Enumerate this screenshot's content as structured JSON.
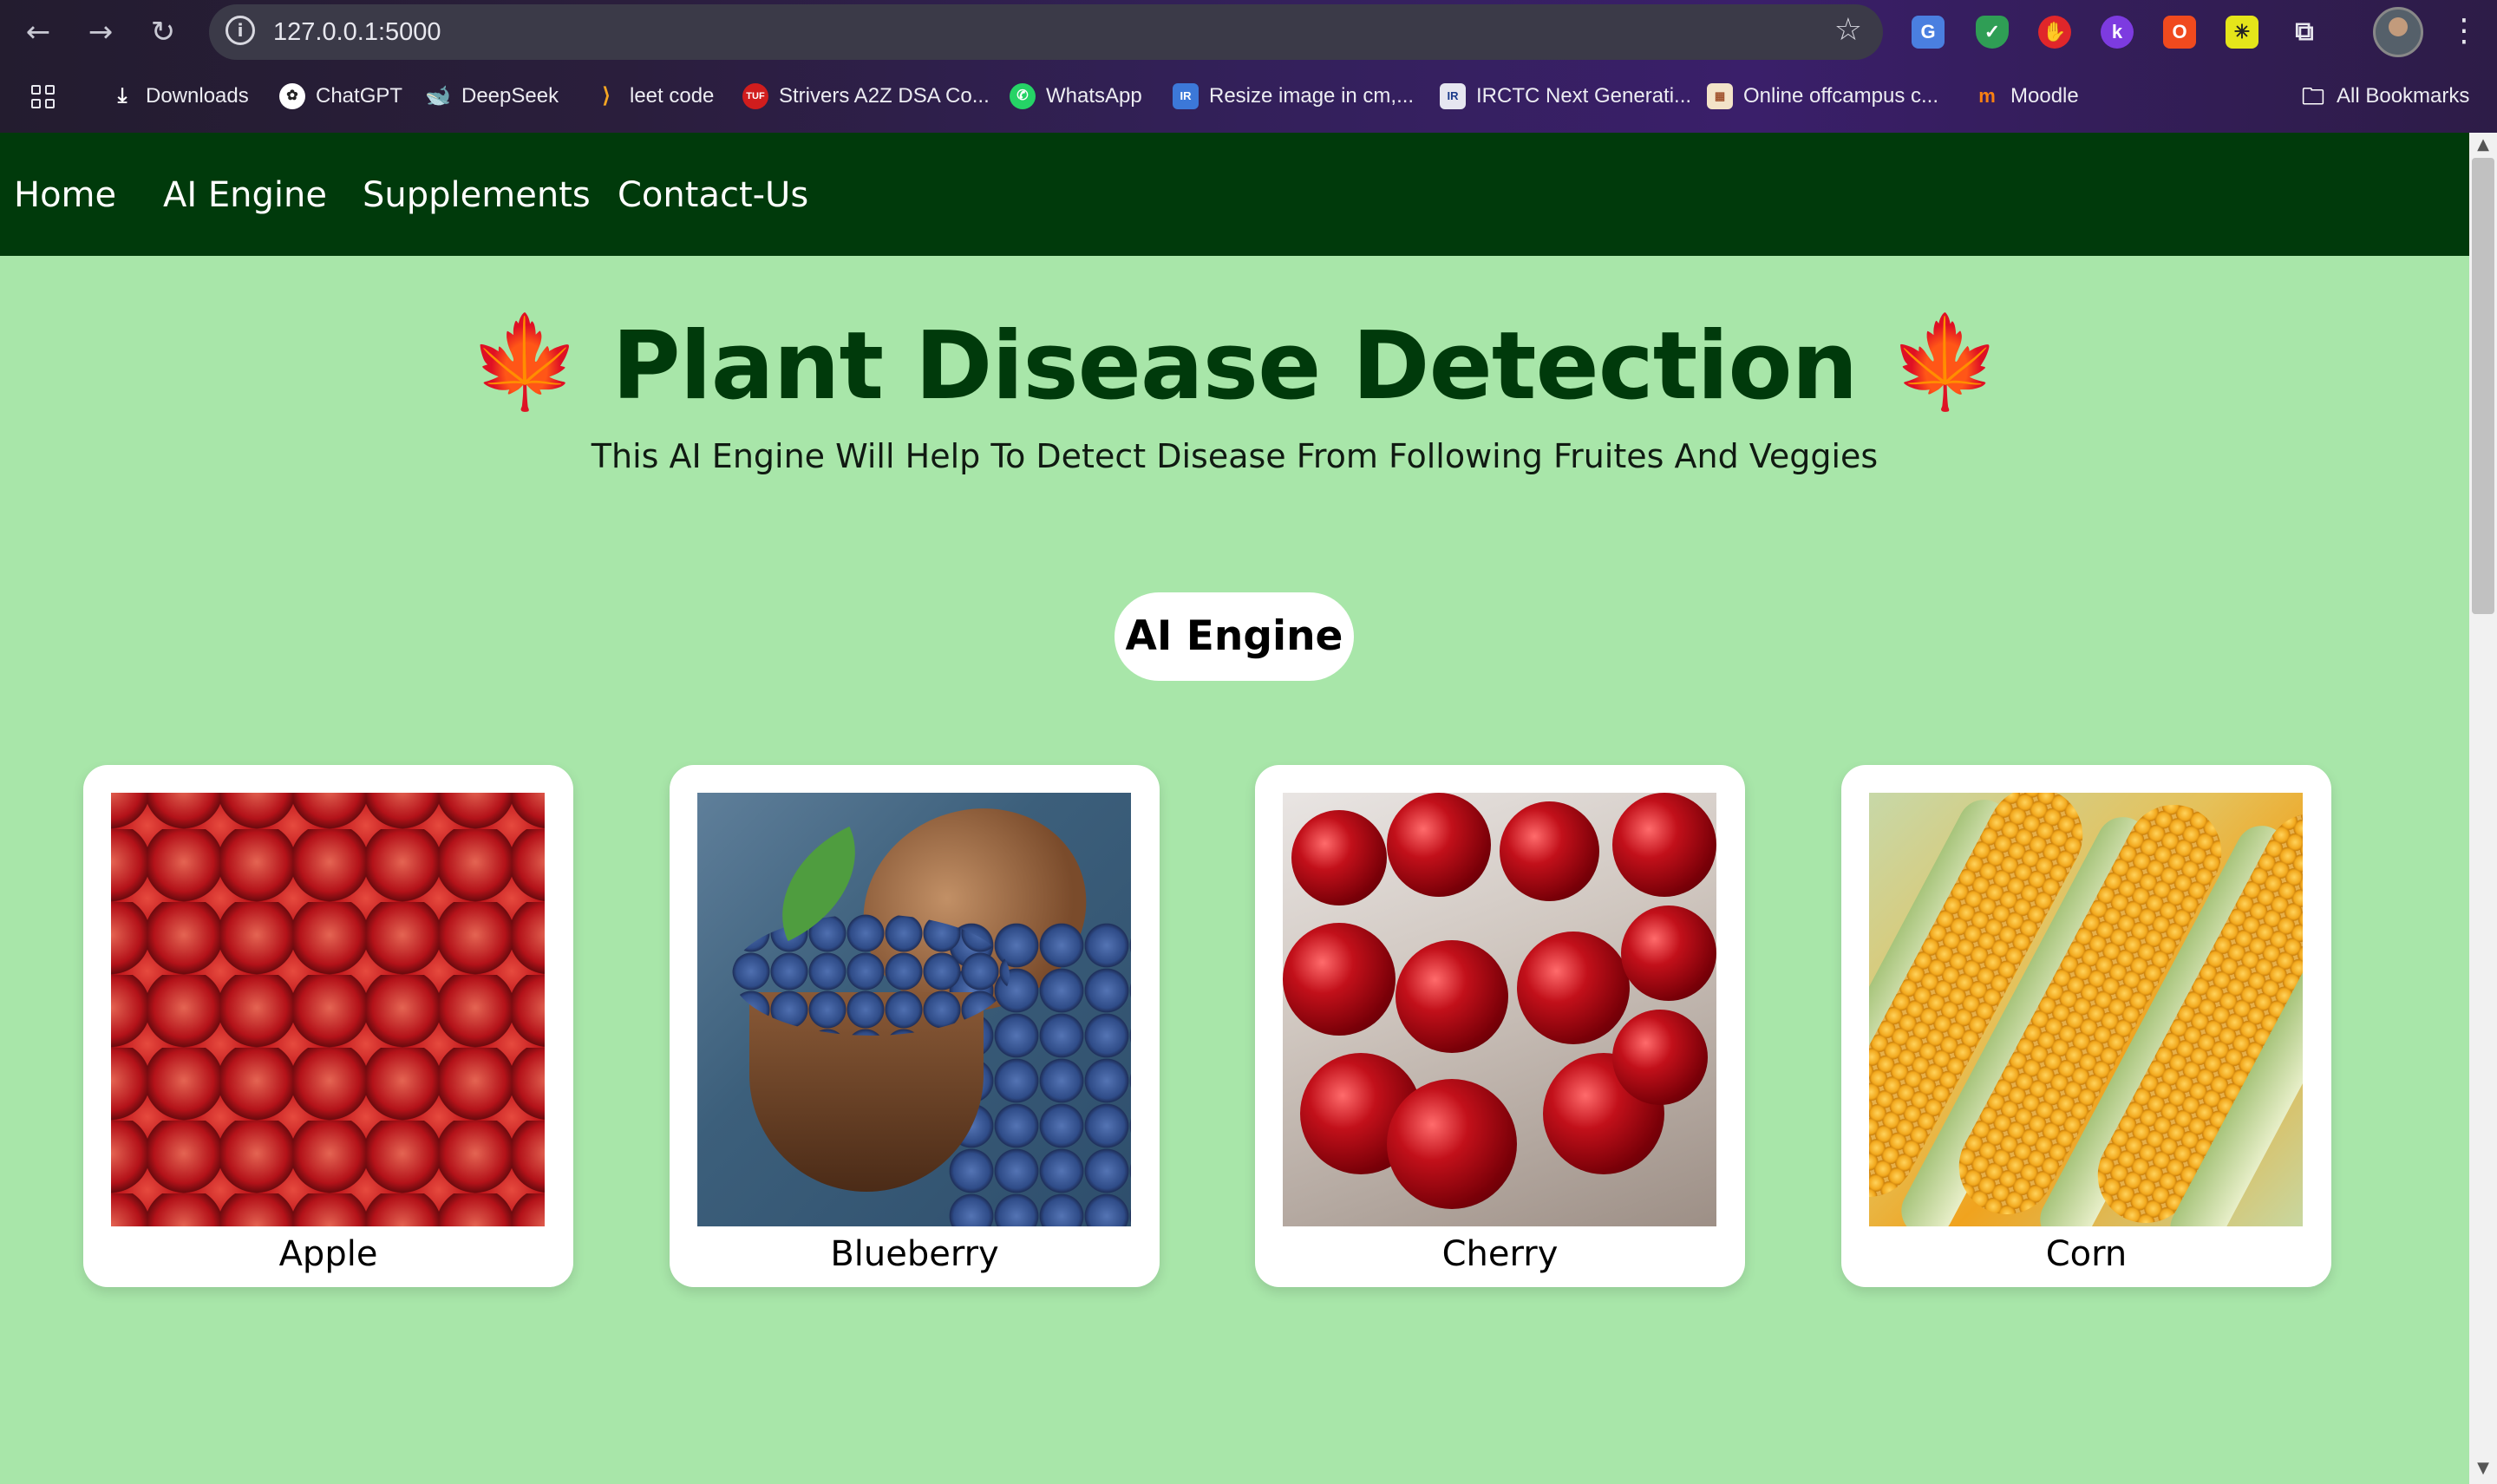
{
  "browser": {
    "url": "127.0.0.1:5000",
    "bookmarks": [
      {
        "label": "Downloads",
        "icon": "download-icon"
      },
      {
        "label": "ChatGPT",
        "icon": "chatgpt-icon"
      },
      {
        "label": "DeepSeek",
        "icon": "deepseek-icon"
      },
      {
        "label": "leet code",
        "icon": "leetcode-icon"
      },
      {
        "label": "Strivers A2Z DSA Co...",
        "icon": "tuf-icon"
      },
      {
        "label": "WhatsApp",
        "icon": "whatsapp-icon"
      },
      {
        "label": "Resize image in cm,...",
        "icon": "resize-icon"
      },
      {
        "label": "IRCTC Next Generati...",
        "icon": "irctc-icon"
      },
      {
        "label": "Online offcampus c...",
        "icon": "offcampus-icon"
      },
      {
        "label": "Moodle",
        "icon": "moodle-icon"
      }
    ],
    "all_bookmarks": "All Bookmarks"
  },
  "nav": {
    "items": [
      "Home",
      "AI Engine",
      "Supplements",
      "Contact-Us"
    ]
  },
  "hero": {
    "title": "Plant Disease Detection",
    "subtitle": "This AI Engine Will Help To Detect Disease From Following Fruites And Veggies",
    "leaf_icon": "maple-leaf-icon"
  },
  "section": {
    "button": "AI Engine"
  },
  "cards": [
    {
      "label": "Apple"
    },
    {
      "label": "Blueberry"
    },
    {
      "label": "Cherry"
    },
    {
      "label": "Corn"
    }
  ],
  "colors": {
    "page_bg": "#a8e6a9",
    "nav_bg": "#003a0b",
    "title": "#003a0b",
    "leaf": "#e53935"
  }
}
